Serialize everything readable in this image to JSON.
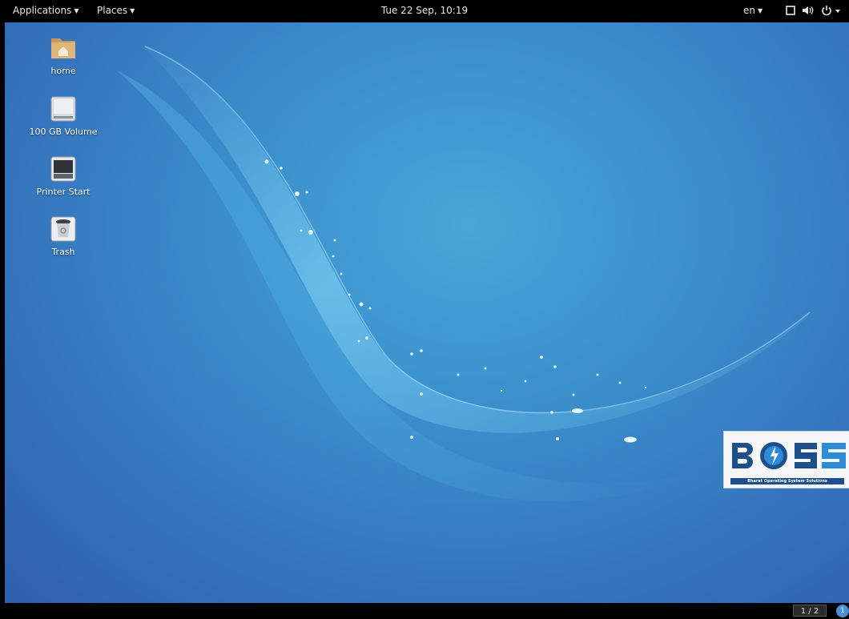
{
  "topbar": {
    "applications_label": "Applications",
    "places_label": "Places",
    "clock": "Tue 22 Sep, 10:19",
    "language": "en"
  },
  "desktop_icons": [
    {
      "label": "home",
      "icon": "home-folder-icon"
    },
    {
      "label": "100 GB Volume",
      "icon": "drive-icon"
    },
    {
      "label": "Printer Start",
      "icon": "printer-icon"
    },
    {
      "label": "Trash",
      "icon": "trash-icon"
    }
  ],
  "logo": {
    "tagline": "Bharat Operating System Solutions",
    "colors": {
      "primary": "#1d4f8a",
      "accent": "#2e8bd6"
    }
  },
  "bottombar": {
    "workspace_indicator": "1 / 2",
    "notification_count": "1"
  }
}
